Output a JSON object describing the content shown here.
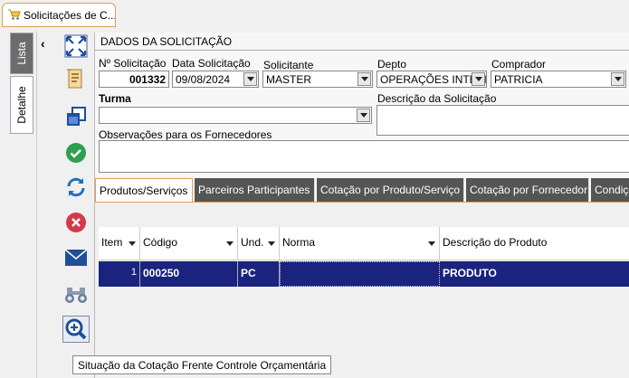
{
  "window_tab": {
    "title": "Solicitações de C...",
    "icon": "cart-icon"
  },
  "side_tabs": {
    "lista": "Lista",
    "detalhe": "Detalhe"
  },
  "toolbar": {
    "items": [
      "expand-icon",
      "document-icon",
      "copy-window-icon",
      "check-icon",
      "refresh-icon",
      "cancel-icon",
      "mail-icon",
      "binoculars-icon",
      "zoom-icon"
    ]
  },
  "form": {
    "section_title": "DADOS DA SOLICITAÇÃO",
    "numero_label": "Nº Solicitação",
    "numero_value": "001332",
    "data_label": "Data Solicitação",
    "data_value": "09/08/2024",
    "solicitante_label": "Solicitante",
    "solicitante_value": "MASTER",
    "depto_label": "Depto",
    "depto_value": "OPERAÇÕES INTERN.",
    "comprador_label": "Comprador",
    "comprador_value": "PATRICIA",
    "turma_label": "Turma",
    "turma_value": "",
    "descricao_label": "Descrição da Solicitação",
    "descricao_value": "",
    "observacoes_label": "Observações para os Fornecedores",
    "observacoes_value": ""
  },
  "tabs": [
    {
      "label": "Produtos/Serviços",
      "active": true
    },
    {
      "label": "Parceiros Participantes",
      "active": false
    },
    {
      "label": "Cotação por Produto/Serviço",
      "active": false
    },
    {
      "label": "Cotação por Fornecedor",
      "active": false
    },
    {
      "label": "Condiçõ",
      "active": false
    }
  ],
  "grid": {
    "columns": [
      "Item",
      "Código",
      "Und.",
      "Norma",
      "Descrição do Produto"
    ],
    "rows": [
      {
        "item": "1",
        "codigo": "000250",
        "und": "PC",
        "norma": "",
        "descricao": "PRODUTO"
      }
    ]
  },
  "tooltip": "Situação da Cotação Frente Controle Orçamentária",
  "colors": {
    "accent": "#e0a050",
    "selected_row": "#1a237e",
    "tab_inactive": "#555555"
  }
}
